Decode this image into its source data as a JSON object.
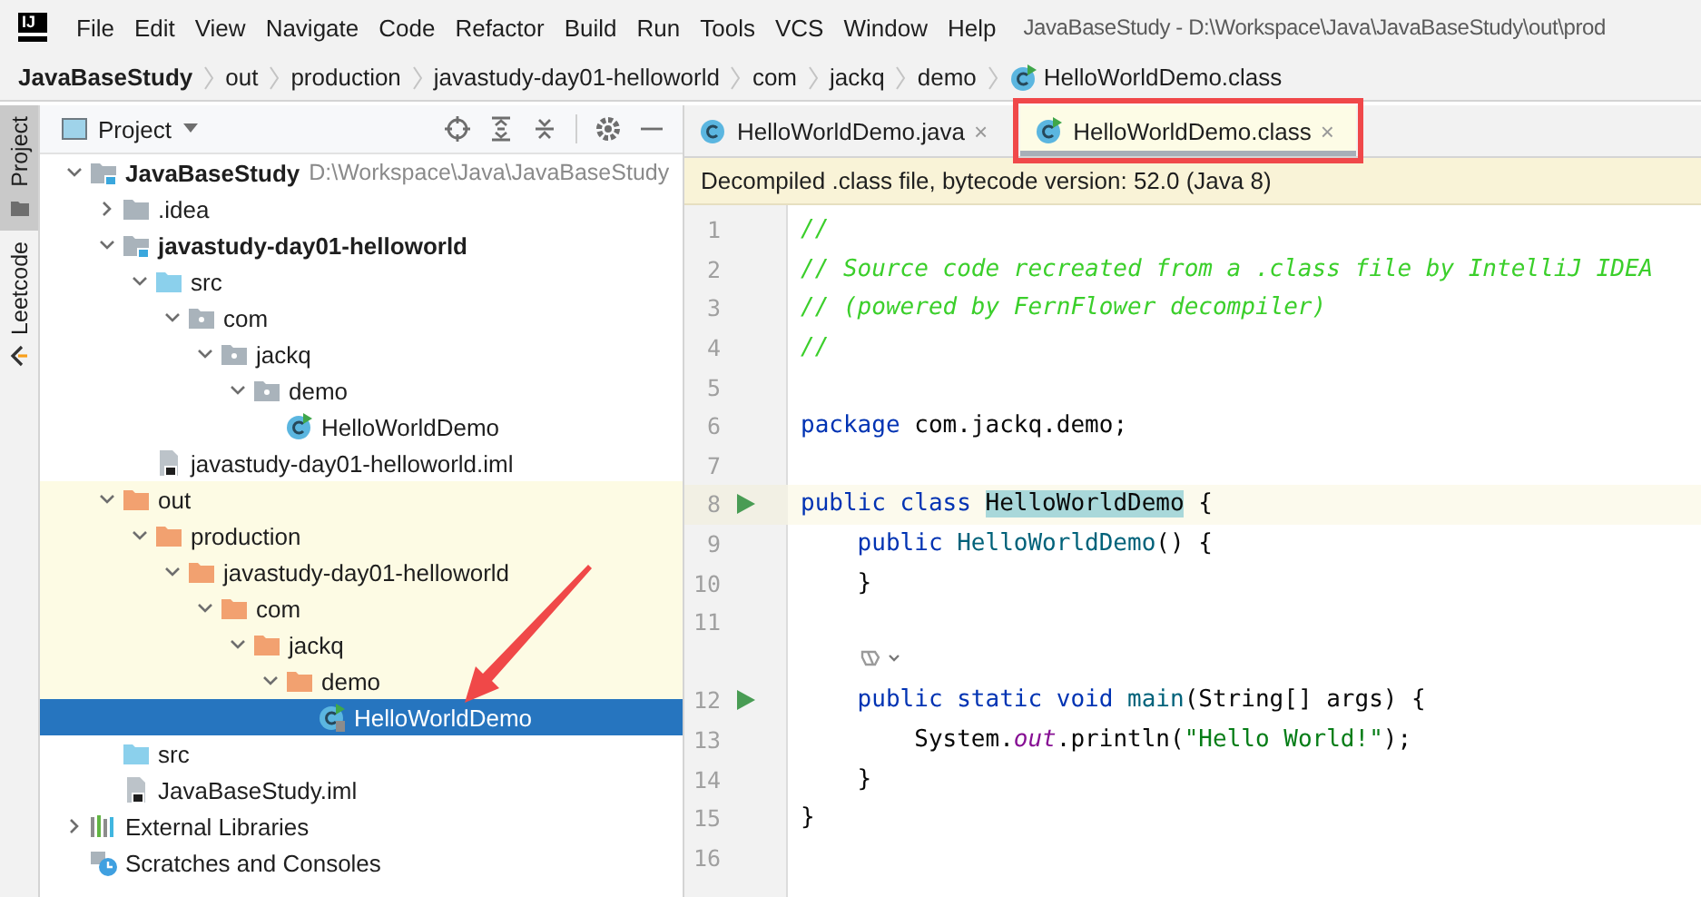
{
  "logo": "IJ",
  "menu": [
    "File",
    "Edit",
    "View",
    "Navigate",
    "Code",
    "Refactor",
    "Build",
    "Run",
    "Tools",
    "VCS",
    "Window",
    "Help"
  ],
  "window_title": "JavaBaseStudy - D:\\Workspace\\Java\\JavaBaseStudy\\out\\prod",
  "breadcrumbs": [
    {
      "label": "JavaBaseStudy",
      "kind": "project"
    },
    {
      "label": "out",
      "kind": "folder"
    },
    {
      "label": "production",
      "kind": "folder"
    },
    {
      "label": "javastudy-day01-helloworld",
      "kind": "folder"
    },
    {
      "label": "com",
      "kind": "folder"
    },
    {
      "label": "jackq",
      "kind": "folder"
    },
    {
      "label": "demo",
      "kind": "folder"
    },
    {
      "label": "HelloWorldDemo.class",
      "kind": "class"
    }
  ],
  "side_tabs": [
    {
      "label": "Project",
      "selected": true,
      "kind": "folder"
    },
    {
      "label": "Leetcode",
      "selected": false,
      "kind": "leetcode"
    }
  ],
  "project_panel": {
    "title": "Project",
    "tree": [
      {
        "label": "JavaBaseStudy",
        "path": "D:\\Workspace\\Java\\JavaBaseStudy",
        "kind": "module",
        "expanded": true,
        "selected": false,
        "children": [
          {
            "label": ".idea",
            "kind": "folder",
            "expanded": false,
            "selected": false
          },
          {
            "label": "javastudy-day01-helloworld",
            "kind": "module",
            "expanded": true,
            "selected": false,
            "children": [
              {
                "label": "src",
                "kind": "source-folder",
                "expanded": true,
                "selected": false,
                "children": [
                  {
                    "label": "com",
                    "kind": "package",
                    "expanded": true,
                    "selected": false,
                    "children": [
                      {
                        "label": "jackq",
                        "kind": "package",
                        "expanded": true,
                        "selected": false,
                        "children": [
                          {
                            "label": "demo",
                            "kind": "package",
                            "expanded": true,
                            "selected": false,
                            "children": [
                              {
                                "label": "HelloWorldDemo",
                                "kind": "class",
                                "selected": false
                              }
                            ]
                          }
                        ]
                      }
                    ]
                  }
                ]
              },
              {
                "label": "javastudy-day01-helloworld.iml",
                "kind": "iml",
                "selected": false
              }
            ]
          },
          {
            "label": "out",
            "kind": "excluded-folder",
            "expanded": true,
            "selected": false,
            "children": [
              {
                "label": "production",
                "kind": "excluded-folder",
                "expanded": true,
                "selected": false,
                "children": [
                  {
                    "label": "javastudy-day01-helloworld",
                    "kind": "excluded-folder",
                    "expanded": true,
                    "selected": false,
                    "children": [
                      {
                        "label": "com",
                        "kind": "excluded-folder",
                        "expanded": true,
                        "selected": false,
                        "children": [
                          {
                            "label": "jackq",
                            "kind": "excluded-folder",
                            "expanded": true,
                            "selected": false,
                            "children": [
                              {
                                "label": "demo",
                                "kind": "excluded-folder",
                                "expanded": true,
                                "selected": false,
                                "children": [
                                  {
                                    "label": "HelloWorldDemo",
                                    "kind": "compiled-class",
                                    "selected": true,
                                    "annotated": true
                                  }
                                ]
                              }
                            ]
                          }
                        ]
                      }
                    ]
                  }
                ]
              }
            ]
          },
          {
            "label": "src",
            "kind": "source-folder",
            "selected": false
          },
          {
            "label": "JavaBaseStudy.iml",
            "kind": "iml",
            "selected": false
          }
        ]
      },
      {
        "label": "External Libraries",
        "kind": "libraries",
        "expanded": false,
        "selected": false
      },
      {
        "label": "Scratches and Consoles",
        "kind": "scratches",
        "selected": false
      }
    ]
  },
  "editor_tabs": [
    {
      "label": "HelloWorldDemo.java",
      "close": "×",
      "selected": false,
      "annotated": false
    },
    {
      "label": "HelloWorldDemo.class",
      "close": "×",
      "selected": true,
      "annotated": true
    }
  ],
  "banner": "Decompiled .class file, bytecode version: 52.0 (Java 8)",
  "code_lines": [
    {
      "kind": "code",
      "number": "1",
      "run": false,
      "current": false,
      "tokens": [
        {
          "kind": "comment",
          "text": "//"
        }
      ]
    },
    {
      "kind": "code",
      "number": "2",
      "run": false,
      "current": false,
      "tokens": [
        {
          "kind": "comment",
          "text": "// Source code recreated from a .class file by IntelliJ IDEA"
        }
      ]
    },
    {
      "kind": "code",
      "number": "3",
      "run": false,
      "current": false,
      "tokens": [
        {
          "kind": "comment",
          "text": "// (powered by FernFlower decompiler)"
        }
      ]
    },
    {
      "kind": "code",
      "number": "4",
      "run": false,
      "current": false,
      "tokens": [
        {
          "kind": "comment",
          "text": "//"
        }
      ]
    },
    {
      "kind": "code",
      "number": "5",
      "run": false,
      "current": false
    },
    {
      "kind": "code",
      "number": "6",
      "run": false,
      "current": false,
      "tokens": [
        {
          "kind": "keyword",
          "text": "package"
        },
        {
          "kind": "plain",
          "text": " com.jackq.demo;"
        }
      ]
    },
    {
      "kind": "code",
      "number": "7",
      "run": false,
      "current": false
    },
    {
      "kind": "code",
      "number": "8",
      "run": true,
      "current": true,
      "tokens": [
        {
          "kind": "keyword",
          "text": "public class "
        },
        {
          "kind": "usage",
          "text": "HelloWorldDemo"
        },
        {
          "kind": "plain",
          "text": " {"
        }
      ]
    },
    {
      "kind": "code",
      "number": "9",
      "run": false,
      "current": false,
      "tokens": [
        {
          "kind": "keyword",
          "text": "    public "
        },
        {
          "kind": "method",
          "text": "HelloWorldDemo"
        },
        {
          "kind": "plain",
          "text": "() {"
        }
      ]
    },
    {
      "kind": "code",
      "number": "10",
      "run": false,
      "current": false,
      "tokens": [
        {
          "kind": "plain",
          "text": "    }"
        }
      ]
    },
    {
      "kind": "code",
      "number": "11",
      "run": false,
      "current": false
    },
    {
      "kind": "hint"
    },
    {
      "kind": "code",
      "number": "12",
      "run": true,
      "current": false,
      "tokens": [
        {
          "kind": "keyword",
          "text": "    public static void "
        },
        {
          "kind": "method",
          "text": "main"
        },
        {
          "kind": "plain",
          "text": "(String[] args) {"
        }
      ]
    },
    {
      "kind": "code",
      "number": "13",
      "run": false,
      "current": false,
      "tokens": [
        {
          "kind": "plain",
          "text": "        System."
        },
        {
          "kind": "static",
          "text": "out"
        },
        {
          "kind": "plain",
          "text": ".println("
        },
        {
          "kind": "string",
          "text": "\"Hello World!\""
        },
        {
          "kind": "plain",
          "text": ");"
        }
      ]
    },
    {
      "kind": "code",
      "number": "14",
      "run": false,
      "current": false,
      "tokens": [
        {
          "kind": "plain",
          "text": "    }"
        }
      ]
    },
    {
      "kind": "code",
      "number": "15",
      "run": false,
      "current": false,
      "tokens": [
        {
          "kind": "plain",
          "text": "}"
        }
      ]
    },
    {
      "kind": "code",
      "number": "16",
      "run": false,
      "current": false
    }
  ]
}
